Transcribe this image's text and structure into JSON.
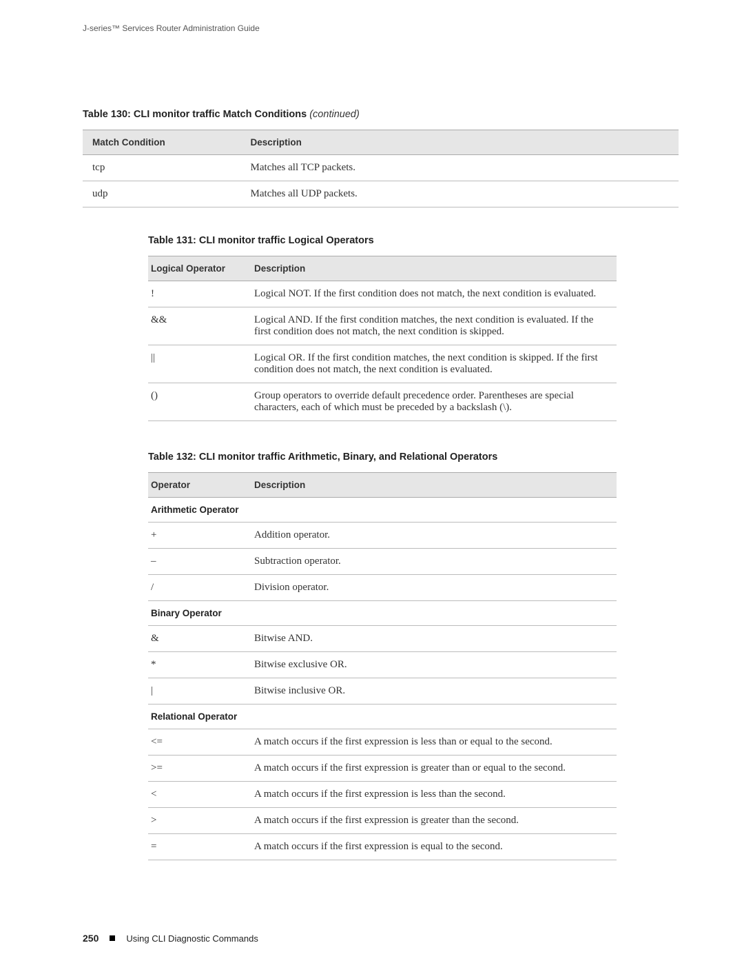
{
  "running_head": "J-series™ Services Router Administration Guide",
  "table130": {
    "caption_strong": "Table 130: CLI monitor traffic Match Conditions",
    "caption_em": " (continued)",
    "headers": [
      "Match Condition",
      "Description"
    ],
    "rows": [
      {
        "c0": "tcp",
        "c1": "Matches all TCP packets."
      },
      {
        "c0": "udp",
        "c1": "Matches all UDP packets."
      }
    ]
  },
  "table131": {
    "caption": "Table 131: CLI monitor traffic Logical Operators",
    "headers": [
      "Logical Operator",
      "Description"
    ],
    "rows": [
      {
        "c0": "!",
        "c1": "Logical NOT. If the first condition does not match, the next condition is evaluated."
      },
      {
        "c0": "&&",
        "c1": "Logical AND. If the first condition matches, the next condition is evaluated. If the first condition does not match, the next condition is skipped."
      },
      {
        "c0": "||",
        "c1": "Logical OR. If the first condition matches, the next condition is skipped. If the first condition does not match, the next condition is evaluated."
      },
      {
        "c0": "()",
        "c1": "Group operators to override default precedence order. Parentheses are special characters, each of which must be preceded by a backslash (\\)."
      }
    ]
  },
  "table132": {
    "caption": "Table 132: CLI monitor traffic Arithmetic, Binary, and Relational Operators",
    "headers": [
      "Operator",
      "Description"
    ],
    "sections": [
      {
        "title": "Arithmetic Operator",
        "rows": [
          {
            "c0": "+",
            "c1": "Addition operator."
          },
          {
            "c0": "–",
            "c1": "Subtraction operator."
          },
          {
            "c0": "/",
            "c1": "Division operator."
          }
        ]
      },
      {
        "title": "Binary Operator",
        "rows": [
          {
            "c0": "&",
            "c1": "Bitwise AND."
          },
          {
            "c0": "*",
            "c1": "Bitwise exclusive OR."
          },
          {
            "c0": "|",
            "c1": "Bitwise inclusive OR."
          }
        ]
      },
      {
        "title": "Relational Operator",
        "rows": [
          {
            "c0": "<=",
            "c1": "A match occurs if the first expression is less than or equal to the second."
          },
          {
            "c0": ">=",
            "c1": "A match occurs if the first expression is greater than or equal to the second."
          },
          {
            "c0": "<",
            "c1": "A match occurs if the first expression is less than the second."
          },
          {
            "c0": ">",
            "c1": "A match occurs if the first expression is greater than the second."
          },
          {
            "c0": "=",
            "c1": "A match occurs if the first expression is equal to the second."
          }
        ]
      }
    ]
  },
  "footer": {
    "page": "250",
    "text": "Using CLI Diagnostic Commands"
  }
}
